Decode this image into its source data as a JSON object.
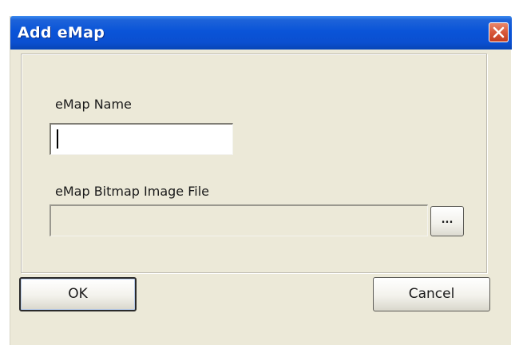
{
  "window": {
    "title": "Add eMap"
  },
  "form": {
    "name_label": "eMap Name",
    "name_value": "",
    "file_label": "eMap Bitmap Image File",
    "file_value": "",
    "browse_label": "..."
  },
  "buttons": {
    "ok_label": "OK",
    "cancel_label": "Cancel"
  },
  "icons": {
    "close": "close-icon"
  },
  "colors": {
    "titlebar": "#0a54d8",
    "close_button": "#d8583a",
    "dialog_background": "#ece9d8"
  }
}
